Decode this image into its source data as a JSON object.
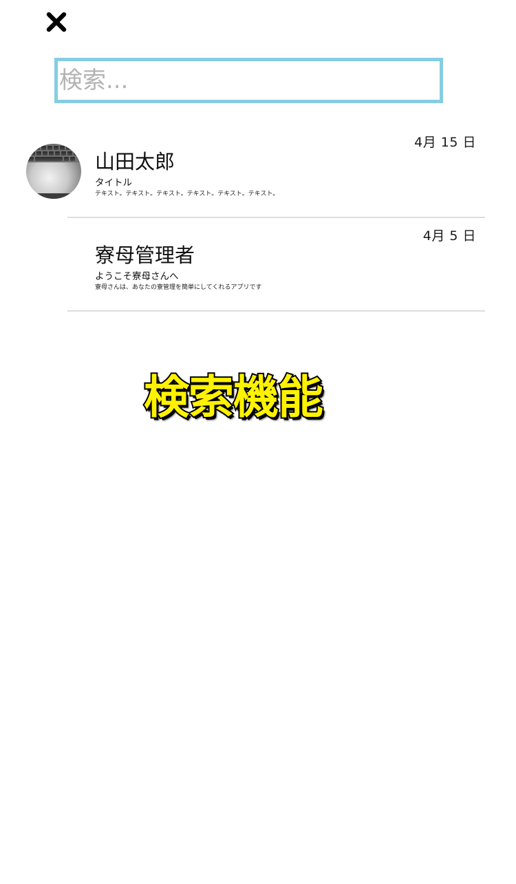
{
  "header": {
    "close_icon": "close-icon"
  },
  "search": {
    "placeholder": "検索..."
  },
  "messages": [
    {
      "name": "山田太郎",
      "date": "4月 15 日",
      "title": "タイトル",
      "text": "テキスト。テキスト。テキスト。テキスト。テキスト。テキスト。",
      "has_avatar": true
    },
    {
      "name": "寮母管理者",
      "date": "4月 5 日",
      "title": "ようこそ寮母さんへ",
      "text": "寮母さんは、あなたの寮管理を簡単にしてくれるアプリです",
      "has_avatar": false
    }
  ],
  "overlay": {
    "caption": "検索機能"
  },
  "colors": {
    "search_border": "#86cde3",
    "caption_fill": "#fff200",
    "caption_stroke": "#000000",
    "divider": "#dddddd"
  }
}
